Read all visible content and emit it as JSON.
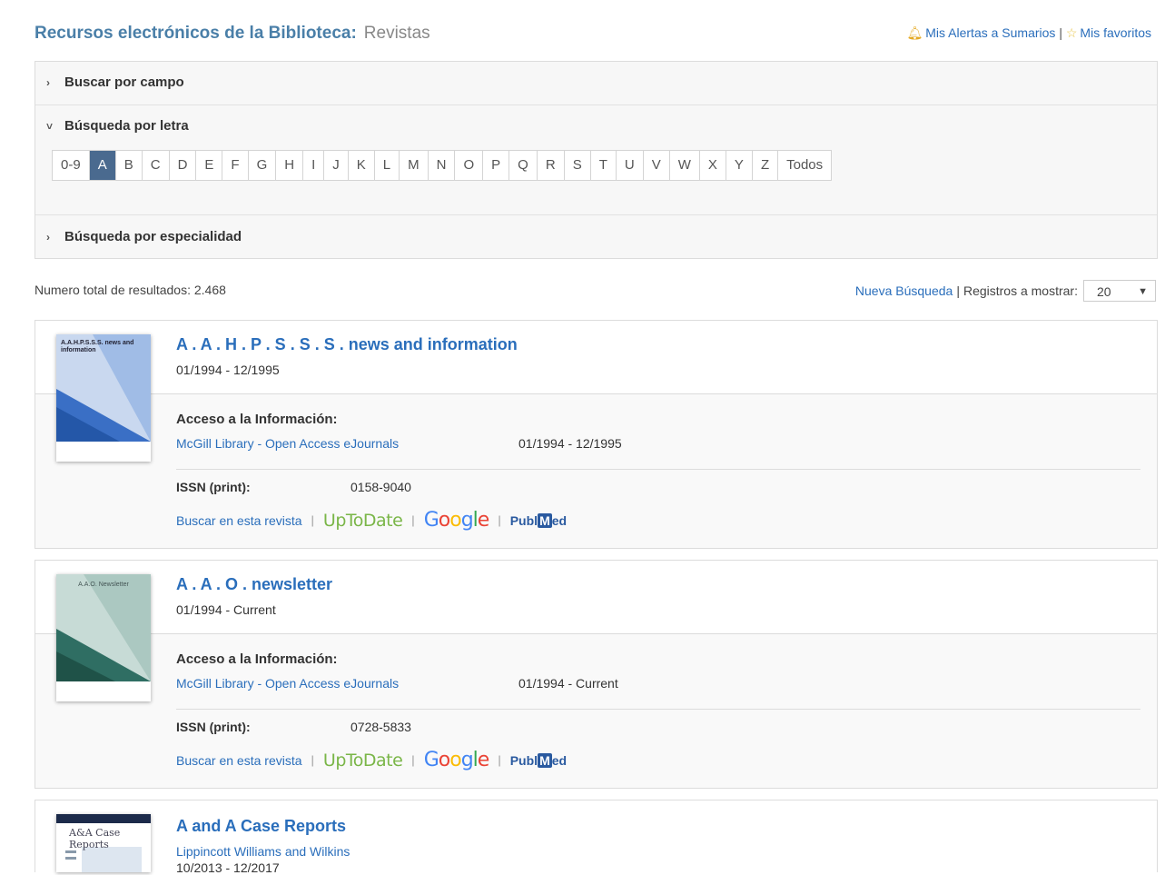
{
  "header": {
    "title": "Recursos electrónicos de la Biblioteca:",
    "subtitle": "Revistas",
    "alerts_label": "Mis Alertas a Sumarios",
    "separator": "|",
    "favorites_label": "Mis favoritos"
  },
  "search": {
    "by_field": "Buscar por campo",
    "by_letter": "Búsqueda por letra",
    "by_specialty": "Búsqueda por especialidad",
    "letters": [
      "0-9",
      "A",
      "B",
      "C",
      "D",
      "E",
      "F",
      "G",
      "H",
      "I",
      "J",
      "K",
      "L",
      "M",
      "N",
      "O",
      "P",
      "Q",
      "R",
      "S",
      "T",
      "U",
      "V",
      "W",
      "X",
      "Y",
      "Z",
      "Todos"
    ],
    "active_letter": "A"
  },
  "results": {
    "total_label": "Numero total de resultados: 2.468",
    "new_search": "Nueva Búsqueda",
    "separator": "|",
    "records_label": "Registros a mostrar:",
    "records_value": "20"
  },
  "journals": [
    {
      "title": "A . A . H . P . S . S . S . news and information",
      "dates": "01/1994 - 12/1995",
      "cover_text": "A.A.H.P.S.S.S. news and information",
      "access_label": "Acceso a la Información:",
      "access_link": "McGill Library - Open Access eJournals",
      "access_dates": "01/1994 - 12/1995",
      "issn_label": "ISSN (print):",
      "issn": "0158-9040",
      "search_in": "Buscar en esta revista"
    },
    {
      "title": "A . A . O . newsletter",
      "dates": "01/1994 - Current",
      "cover_text": "A.A.O. Newsletter",
      "access_label": "Acceso a la Información:",
      "access_link": "McGill Library - Open Access eJournals",
      "access_dates": "01/1994 - Current",
      "issn_label": "ISSN (print):",
      "issn": "0728-5833",
      "search_in": "Buscar en esta revista"
    },
    {
      "title": "A and A Case Reports",
      "publisher": "Lippincott Williams and Wilkins",
      "dates": "10/2013 - 12/2017",
      "cover_text": "A&A Case Reports"
    }
  ],
  "tools": {
    "uptodate": "UpToDate",
    "google": [
      "G",
      "o",
      "o",
      "g",
      "l",
      "e"
    ],
    "pubmed_pre": "Publ",
    "pubmed_m": "M",
    "pubmed_post": "ed"
  },
  "colors": {
    "link": "#2a6ebb",
    "active_letter_bg": "#4a6a8f",
    "uptodate": "#7ab648",
    "google": [
      "#4285f4",
      "#ea4335",
      "#fbbc05",
      "#4285f4",
      "#34a853",
      "#ea4335"
    ]
  },
  "icons": [
    "bell-icon",
    "star-icon",
    "chevron-right-icon",
    "chevron-down-icon",
    "dropdown-arrow-icon"
  ]
}
